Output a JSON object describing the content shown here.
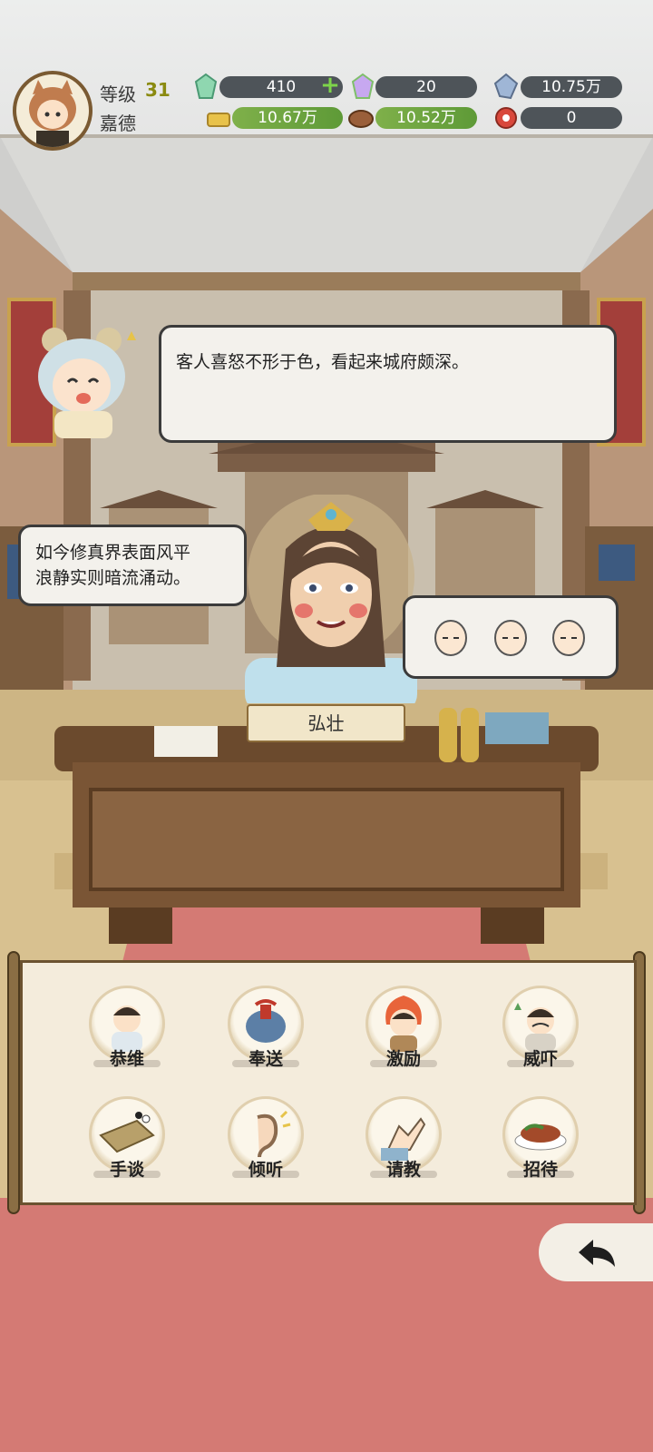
{
  "player": {
    "level_label": "等级",
    "level": "31",
    "name": "嘉德"
  },
  "resources": {
    "jade": "410",
    "rainbow_gem": "20",
    "crystal": "10.75万",
    "gold": "10.67万",
    "wood": "10.52万",
    "red_item": "0"
  },
  "dialogs": {
    "narrator": "客人喜怒不形于色，看起来城府颇深。",
    "guest_line1": "如今修真界表面风平",
    "guest_line2": "浪静实则暗流涌动。"
  },
  "guest": {
    "name": "弘壮"
  },
  "actions": [
    {
      "label": "恭维",
      "icon": "flatter-icon"
    },
    {
      "label": "奉送",
      "icon": "gift-icon"
    },
    {
      "label": "激励",
      "icon": "encourage-icon"
    },
    {
      "label": "威吓",
      "icon": "intimidate-icon"
    },
    {
      "label": "手谈",
      "icon": "go-board-icon"
    },
    {
      "label": "倾听",
      "icon": "ear-icon"
    },
    {
      "label": "请教",
      "icon": "consult-icon"
    },
    {
      "label": "招待",
      "icon": "feast-icon"
    }
  ],
  "colors": {
    "accent_green": "#7fb04a",
    "panel_border": "#6b5230",
    "carpet": "#d47a74"
  }
}
